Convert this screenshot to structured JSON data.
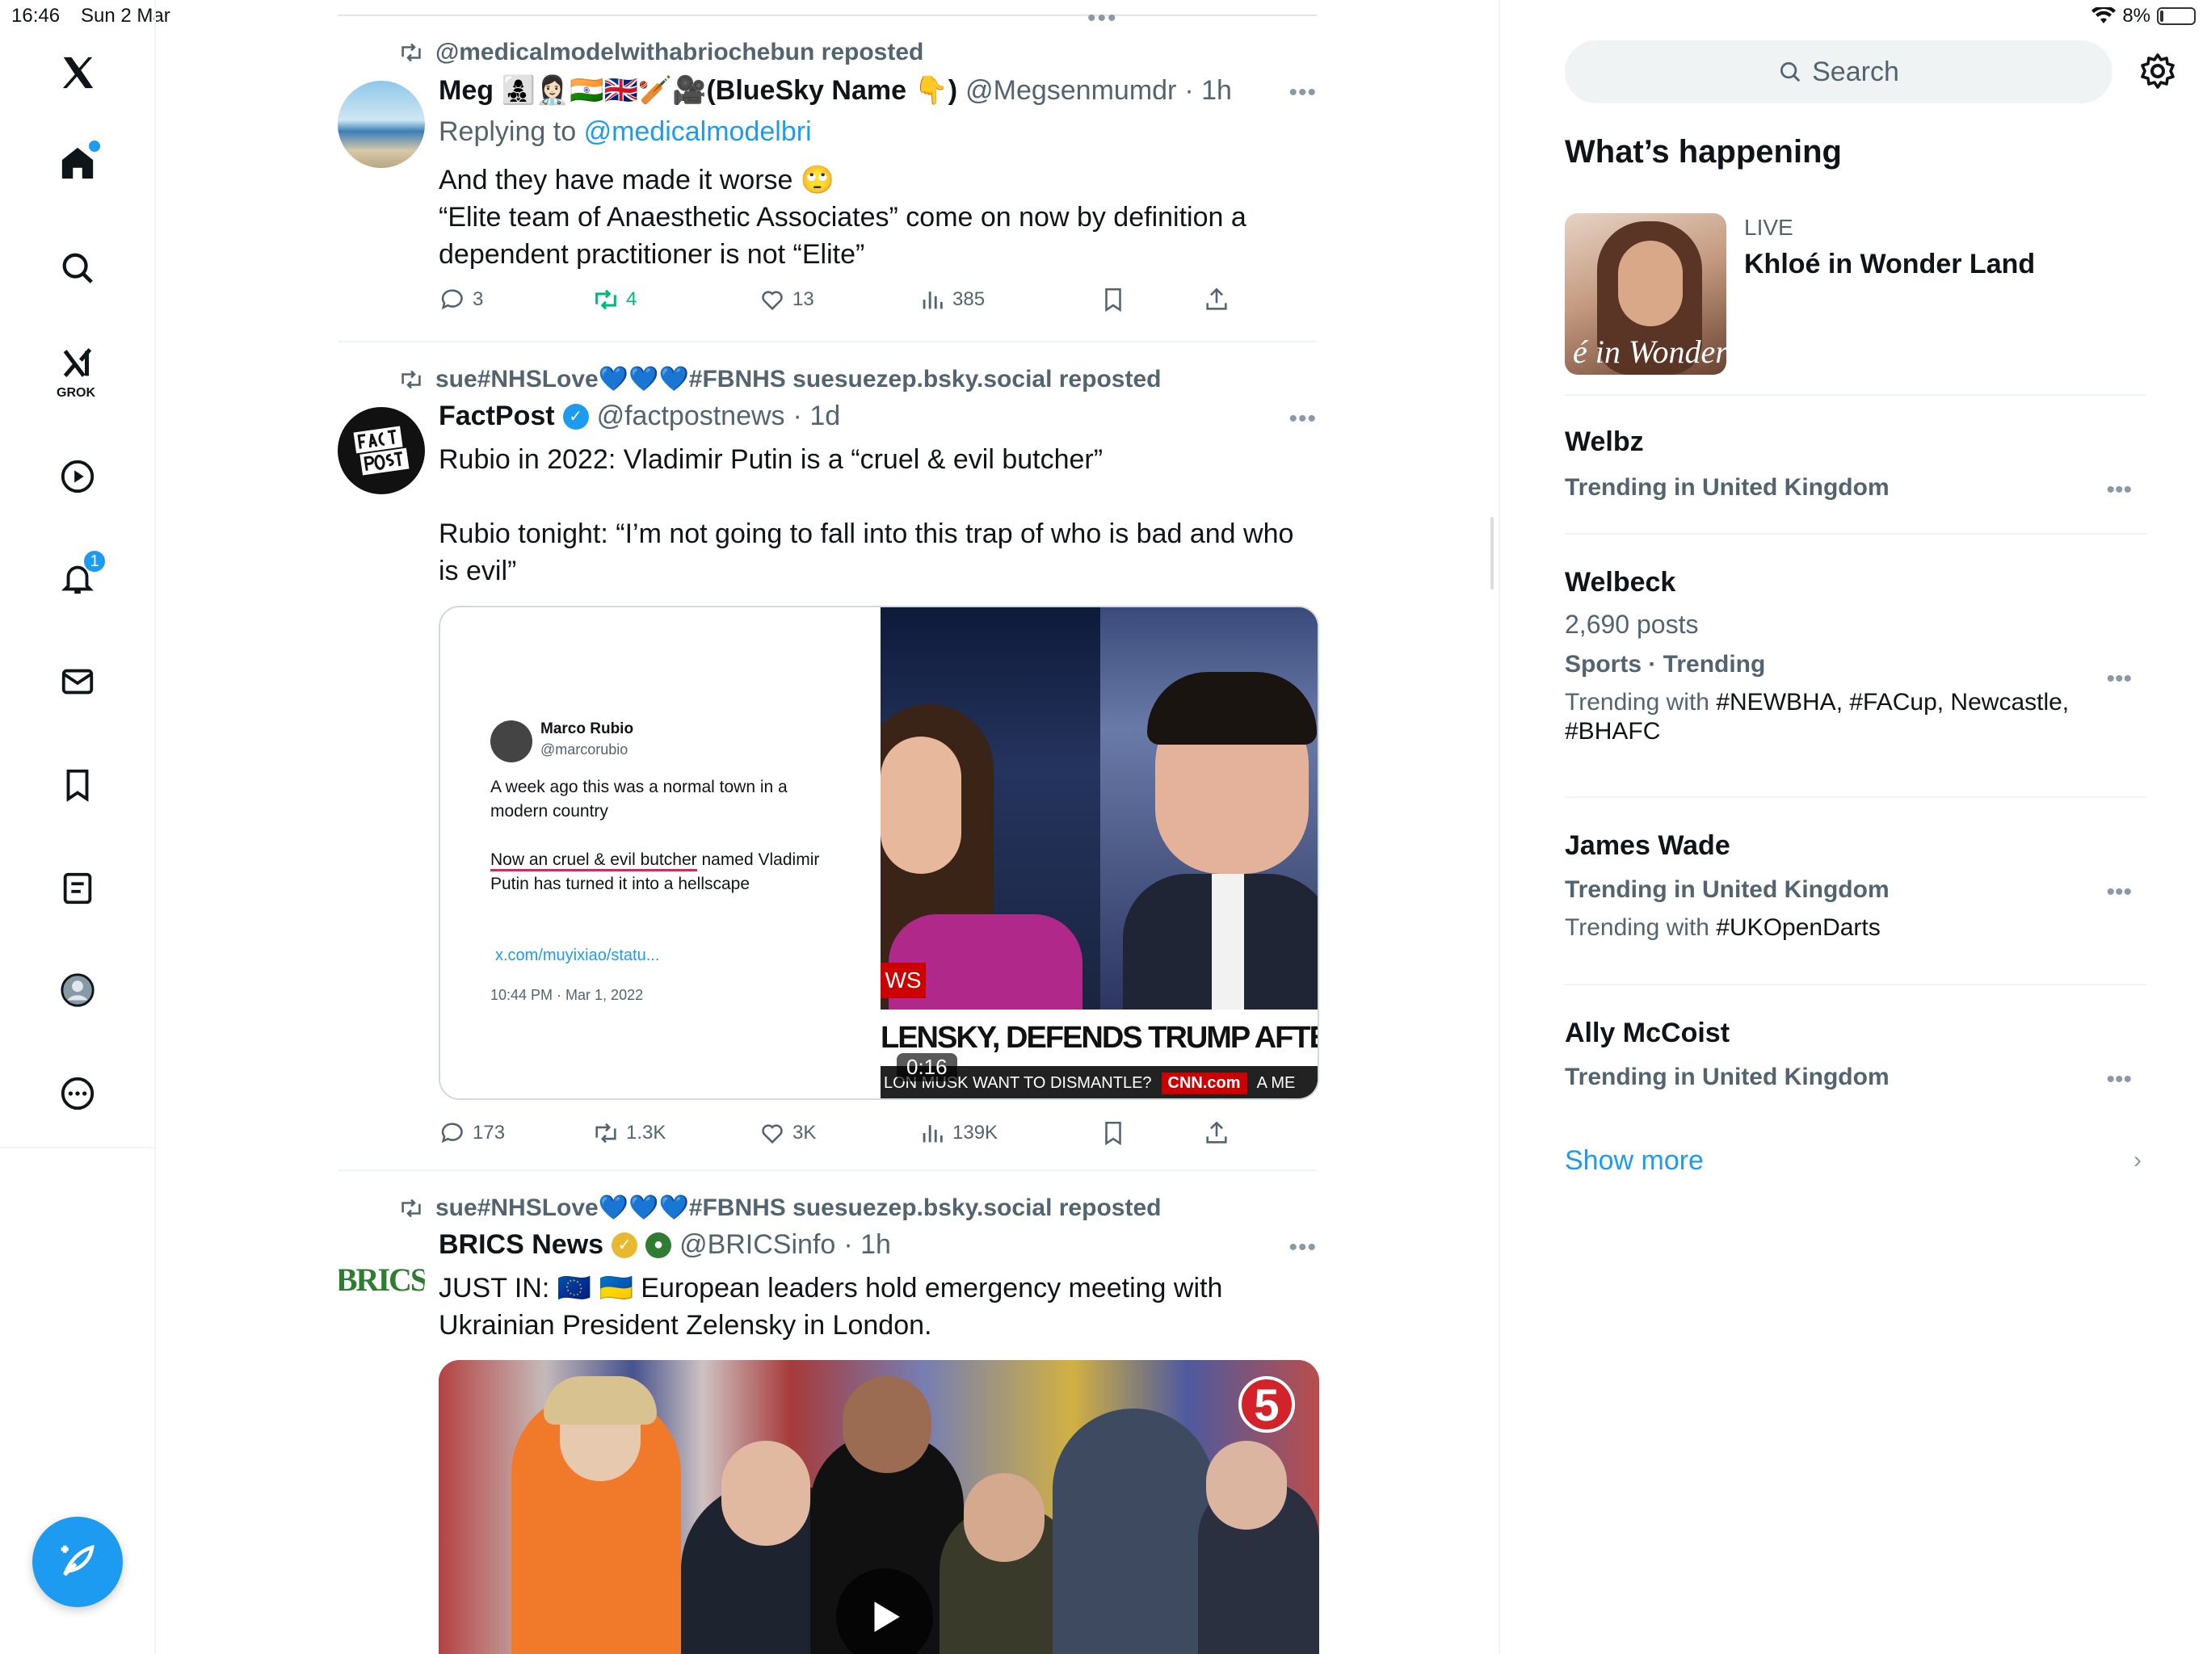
{
  "status": {
    "time": "16:46",
    "date": "Sun 2 Mar",
    "battery": "8%"
  },
  "nav": {
    "grok_label": "GROK",
    "notifications_count": "1",
    "icons": [
      "x-logo-icon",
      "home-icon",
      "search-icon",
      "grok-icon",
      "video-icon",
      "notifications-icon",
      "messages-icon",
      "bookmarks-icon",
      "lists-icon",
      "profile-icon",
      "more-icon"
    ]
  },
  "feed": {
    "posts": [
      {
        "reposted_by": "@medicalmodelwithabriochebun reposted",
        "name": "Meg 👩‍👧‍👦👩🏻‍⚕️🇮🇳🇬🇧🏏🎥(BlueSky Name 👇)",
        "handle": "@Megsenmumdr",
        "time": "· 1h",
        "replying_label": "Replying to",
        "replying_to": "@medicalmodelbri",
        "text": "And they have made it worse 🙄\n“Elite team of Anaesthetic Associates” come on now by definition a dependent practitioner is not “Elite”",
        "replies": "3",
        "reposts": "4",
        "likes": "13",
        "views": "385"
      },
      {
        "reposted_by": "sue#NHSLove💙💙💙#FBNHS suesuezep.bsky.social reposted",
        "name": "FactPost",
        "handle": "@factpostnews",
        "time": "· 1d",
        "text": "Rubio in 2022: Vladimir Putin is a “cruel & evil butcher”\n\nRubio tonight: “I’m not going to fall into this trap of who is bad and who is evil”",
        "embedded": {
          "name": "Marco Rubio",
          "handle": "@marcorubio",
          "line1": "A week ago this was a normal town in a modern country",
          "line2_underlined": "Now an cruel & evil butcher",
          "line2_rest": " named Vladimir Putin has turned it into a hellscape",
          "link": "x.com/muyixiao/statu...",
          "date": "10:44 PM · Mar 1, 2022"
        },
        "video": {
          "tag": "WS",
          "ticker": "LENSKY, DEFENDS TRUMP AFTER OVAL OFFICE",
          "ticker2": "LON MUSK WANT TO DISMANTLE?",
          "network": "CNN.com",
          "ticker2_tail": "A ME",
          "duration": "0:16"
        },
        "replies": "173",
        "reposts": "1.3K",
        "likes": "3K",
        "views": "139K"
      },
      {
        "reposted_by": "sue#NHSLove💙💙💙#FBNHS suesuezep.bsky.social reposted",
        "name": "BRICS News",
        "handle": "@BRICSinfo",
        "time": "· 1h",
        "avatar_text": "BRICS",
        "text": "JUST IN: 🇪🇺 🇺🇦 European leaders hold emergency meeting with Ukrainian President Zelensky in London.",
        "channel_badge": "5"
      }
    ]
  },
  "right": {
    "search_placeholder": "Search",
    "section_title": "What’s happening",
    "live": {
      "label": "LIVE",
      "title": "Khloé in Wonder Land",
      "thumb_caption": "é in Wonder l"
    },
    "trends": [
      {
        "name": "Welbz",
        "meta": "Trending in United Kingdom"
      },
      {
        "name": "Welbeck",
        "count": "2,690 posts",
        "meta": "Sports · Trending",
        "with_label": "Trending with",
        "with": "#NEWBHA, #FACup, Newcastle, #BHAFC"
      },
      {
        "name": "James Wade",
        "meta": "Trending in United Kingdom",
        "with_label": "Trending with",
        "with": "#UKOpenDarts"
      },
      {
        "name": "Ally McCoist",
        "meta": "Trending in United Kingdom"
      }
    ],
    "show_more": "Show more"
  }
}
